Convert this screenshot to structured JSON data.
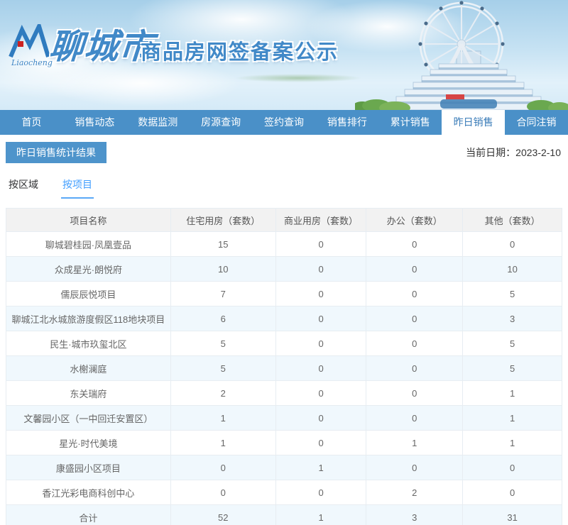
{
  "banner": {
    "logo_text": "Liaocheng",
    "brand": "聊城市",
    "title": "商品房网签备案公示"
  },
  "nav": {
    "items": [
      {
        "name": "home",
        "label": "首页",
        "active": false
      },
      {
        "name": "sales-trends",
        "label": "销售动态",
        "active": false
      },
      {
        "name": "data-monitor",
        "label": "数据监测",
        "active": false
      },
      {
        "name": "listing-query",
        "label": "房源查询",
        "active": false
      },
      {
        "name": "signing-query",
        "label": "签约查询",
        "active": false
      },
      {
        "name": "sales-ranking",
        "label": "销售排行",
        "active": false
      },
      {
        "name": "cumulative-sales",
        "label": "累计销售",
        "active": false
      },
      {
        "name": "yesterday-sales",
        "label": "昨日销售",
        "active": true
      },
      {
        "name": "contract-cancellation",
        "label": "合同注销",
        "active": false
      }
    ]
  },
  "section": {
    "title": "昨日销售统计结果",
    "date_label": "当前日期：",
    "date_value": "2023-2-10"
  },
  "subtabs": [
    {
      "name": "by-region",
      "label": "按区域",
      "active": false
    },
    {
      "name": "by-project",
      "label": "按项目",
      "active": true
    }
  ],
  "table": {
    "columns": [
      "项目名称",
      "住宅用房（套数）",
      "商业用房（套数）",
      "办公（套数）",
      "其他（套数）"
    ],
    "rows": [
      [
        "聊城碧桂园·凤凰壹品",
        "15",
        "0",
        "0",
        "0"
      ],
      [
        "众成星光·朗悦府",
        "10",
        "0",
        "0",
        "10"
      ],
      [
        "儒辰辰悦项目",
        "7",
        "0",
        "0",
        "5"
      ],
      [
        "聊城江北水城旅游度假区118地块项目",
        "6",
        "0",
        "0",
        "3"
      ],
      [
        "民生·城市玖玺北区",
        "5",
        "0",
        "0",
        "5"
      ],
      [
        "水榭澜庭",
        "5",
        "0",
        "0",
        "5"
      ],
      [
        "东关瑞府",
        "2",
        "0",
        "0",
        "1"
      ],
      [
        "文馨园小区（一中回迁安置区）",
        "1",
        "0",
        "0",
        "1"
      ],
      [
        "星光·时代美境",
        "1",
        "0",
        "1",
        "1"
      ],
      [
        "康盛园小区项目",
        "0",
        "1",
        "0",
        "0"
      ],
      [
        "香江光彩电商科创中心",
        "0",
        "0",
        "2",
        "0"
      ],
      [
        "合计",
        "52",
        "1",
        "3",
        "31"
      ]
    ]
  },
  "colors": {
    "nav_blue": "#4a90c8",
    "active_nav_text": "#3a7cb8",
    "subtab_active": "#409eff",
    "badge_bg": "#4e94cb",
    "table_header_bg": "#f2f2f2",
    "row_alt_bg": "#f0f8fd",
    "brand_blue": "#4189c8"
  }
}
